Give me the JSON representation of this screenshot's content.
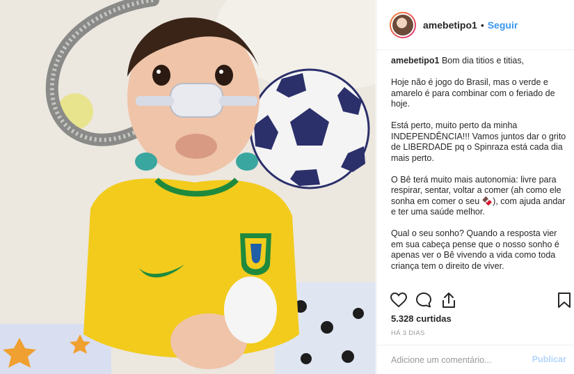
{
  "post": {
    "username": "amebetipo1",
    "separator": "•",
    "follow_label": "Seguir",
    "caption_user": "amebetipo1",
    "caption_first": "Bom dia titios e titias,",
    "paragraphs": [
      "Hoje não é jogo do Brasil, mas o verde e amarelo é para combinar com o feriado de hoje.",
      "Está perto, muito perto da minha INDEPENDÊNCIA!!! Vamos juntos dar o grito de LIBERDADE pq o Spinraza está cada dia mais perto.",
      "O Bê terá muito mais autonomia: livre para respirar, sentar, voltar a comer (ah como ele sonha em comer o seu 🍫), com ajuda andar e ter uma saúde melhor.",
      "Qual o seu sonho? Quando a resposta vier em sua cabeça pense que o nosso sonho é apenas ver o Bê vivendo a vida como toda criança tem o direito de viver."
    ],
    "likes": "5.328 curtidas",
    "time": "HÁ 3 DIAS",
    "comment_placeholder": "Adicione um comentário...",
    "publish_label": "Publicar"
  },
  "icons": {
    "like": "heart-icon",
    "comment": "comment-icon",
    "share": "share-icon",
    "save": "bookmark-icon"
  },
  "colors": {
    "link": "#3897f0",
    "jersey_yellow": "#f2cb1d",
    "jersey_green": "#1f8a3e"
  }
}
